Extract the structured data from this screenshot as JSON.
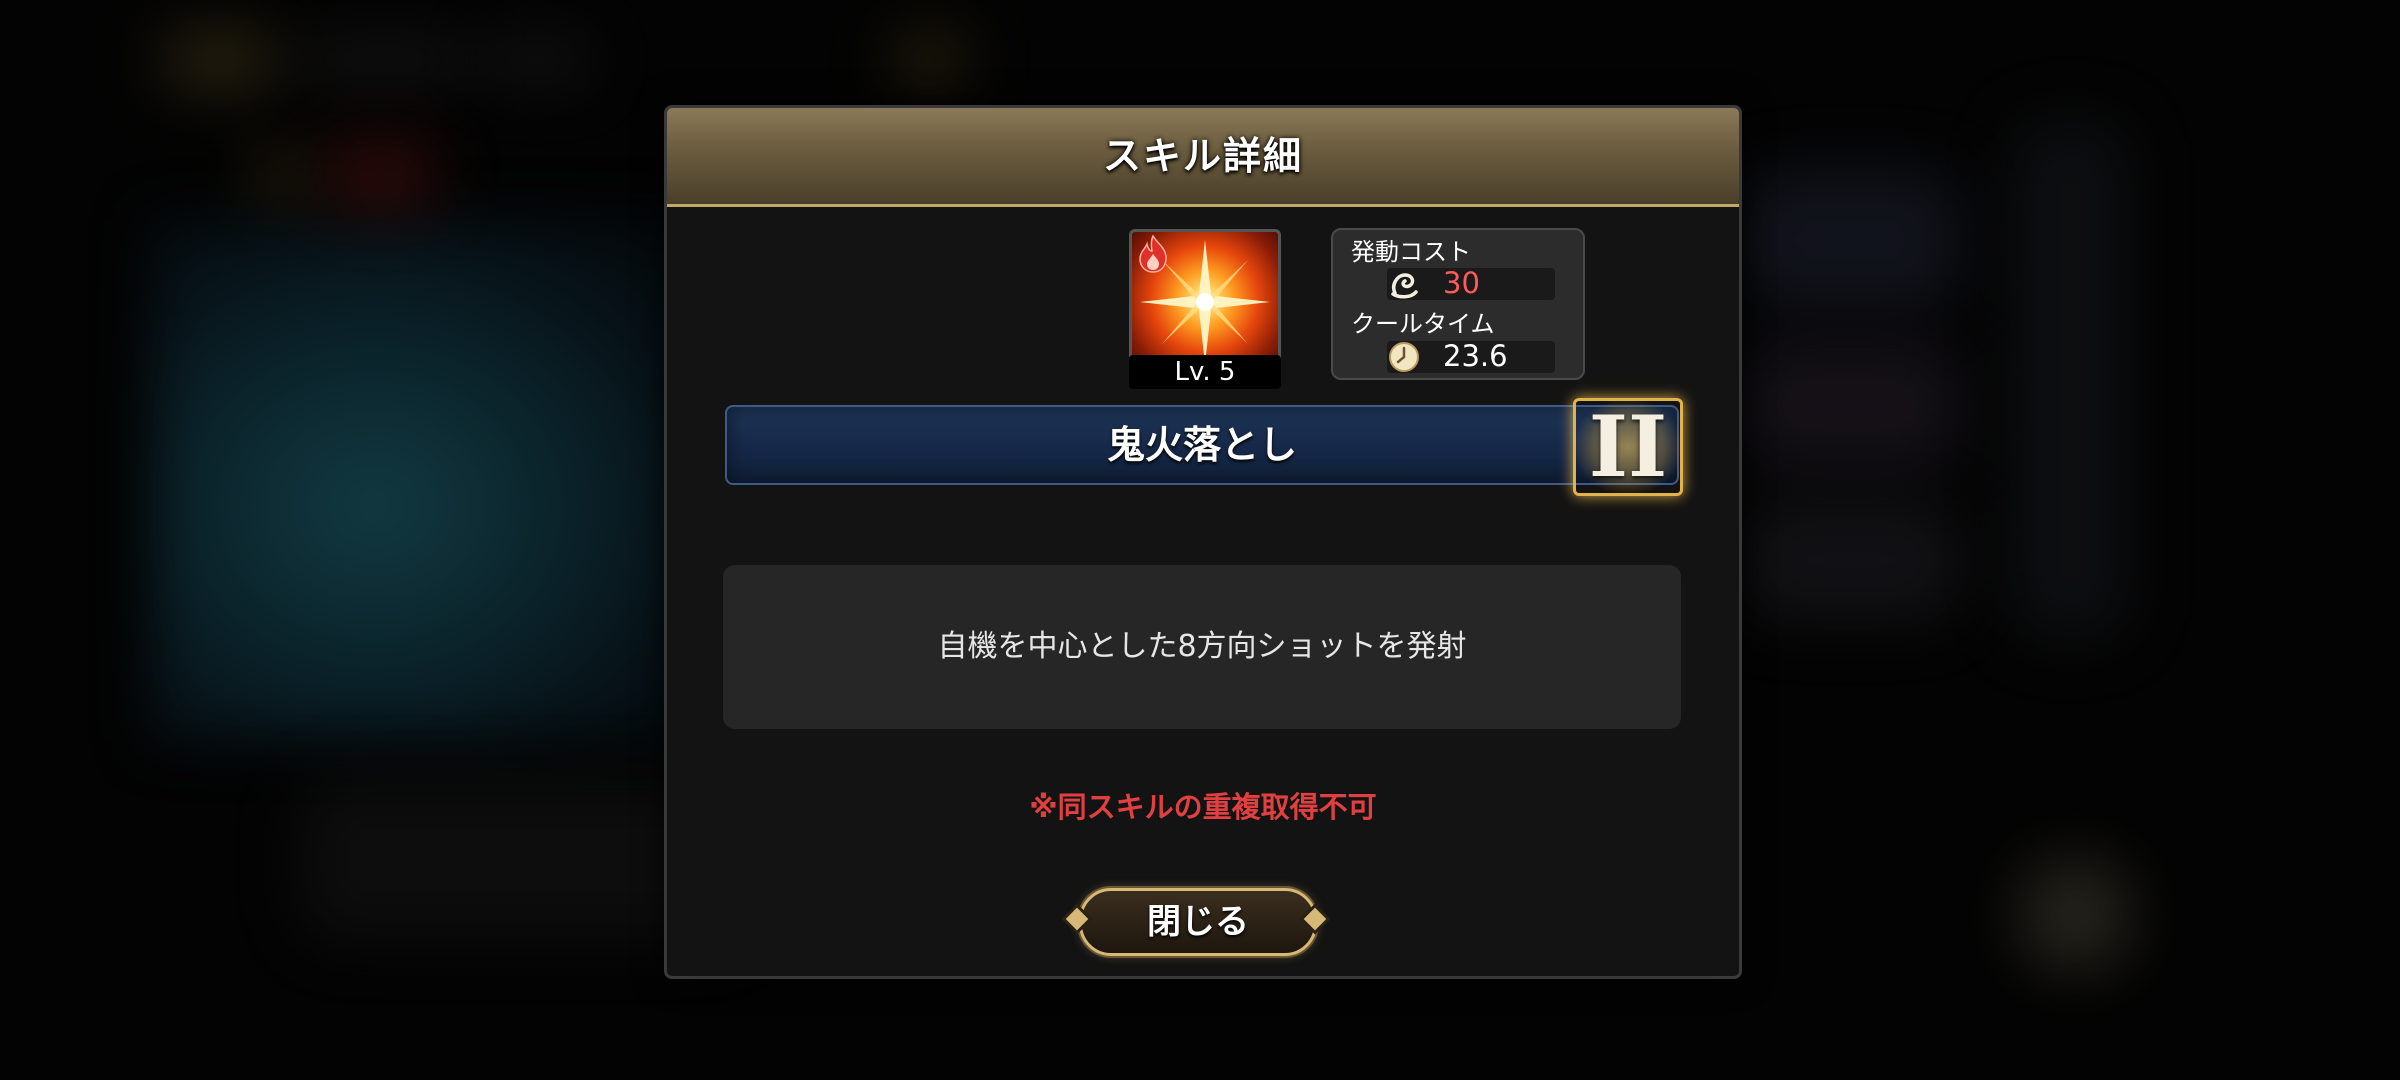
{
  "dialog": {
    "title": "スキル詳細",
    "close_label": "閉じる"
  },
  "skill": {
    "level": "Lv. 5",
    "element_icon": "fire-icon",
    "name": "鬼火落とし",
    "rank": "II",
    "description": "自機を中心とした8方向ショットを発射",
    "note": "※同スキルの重複取得不可"
  },
  "stats": {
    "cost_label": "発動コスト",
    "cost_icon": "cost-swirl-icon",
    "cost_value": "30",
    "cooldown_label": "クールタイム",
    "cooldown_icon": "clock-icon",
    "cooldown_value": "23.6"
  },
  "colors": {
    "header": "#7a6a4a",
    "cost_value": "#ff5a5a",
    "note": "#e24040",
    "name_bar": "#1a2e50",
    "gold_accent": "#d6b877"
  }
}
